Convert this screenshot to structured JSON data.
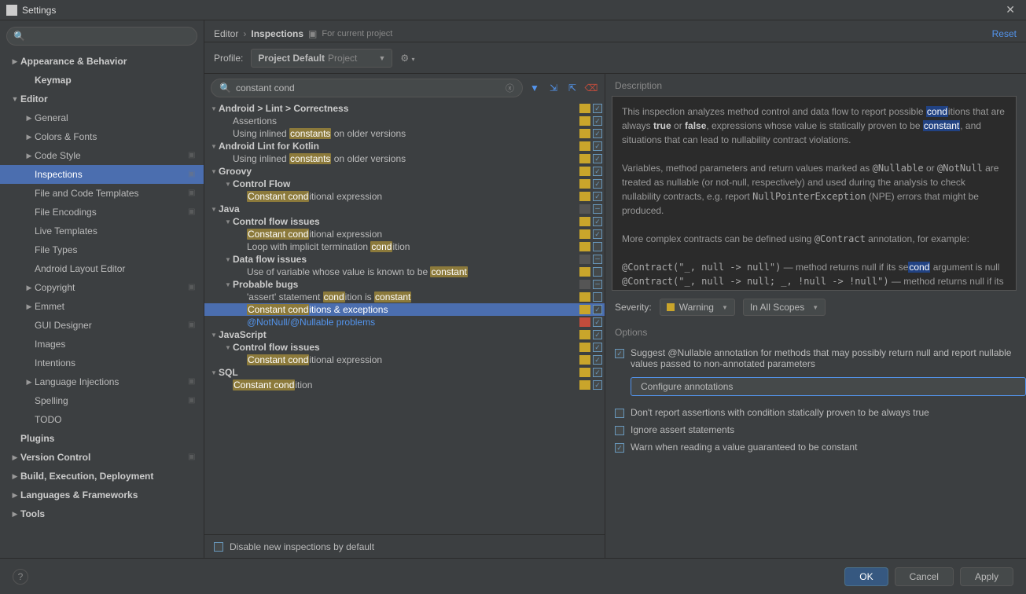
{
  "window": {
    "title": "Settings"
  },
  "header": {
    "crumb1": "Editor",
    "crumb2": "Inspections",
    "scope_label": "For current project",
    "reset": "Reset"
  },
  "profile": {
    "label": "Profile:",
    "name": "Project Default",
    "suffix": "Project"
  },
  "sidebar_search": "",
  "sidebar": [
    {
      "label": "Appearance & Behavior",
      "depth": 0,
      "arrow": "▶",
      "bold": true
    },
    {
      "label": "Keymap",
      "depth": 1,
      "arrow": "",
      "bold": true
    },
    {
      "label": "Editor",
      "depth": 0,
      "arrow": "▼",
      "bold": true
    },
    {
      "label": "General",
      "depth": 1,
      "arrow": "▶",
      "bold": false
    },
    {
      "label": "Colors & Fonts",
      "depth": 1,
      "arrow": "▶",
      "bold": false
    },
    {
      "label": "Code Style",
      "depth": 1,
      "arrow": "▶",
      "bold": false,
      "badge": true
    },
    {
      "label": "Inspections",
      "depth": 1,
      "arrow": "",
      "bold": false,
      "selected": true,
      "badge": true
    },
    {
      "label": "File and Code Templates",
      "depth": 1,
      "arrow": "",
      "bold": false,
      "badge": true
    },
    {
      "label": "File Encodings",
      "depth": 1,
      "arrow": "",
      "bold": false,
      "badge": true
    },
    {
      "label": "Live Templates",
      "depth": 1,
      "arrow": "",
      "bold": false
    },
    {
      "label": "File Types",
      "depth": 1,
      "arrow": "",
      "bold": false
    },
    {
      "label": "Android Layout Editor",
      "depth": 1,
      "arrow": "",
      "bold": false
    },
    {
      "label": "Copyright",
      "depth": 1,
      "arrow": "▶",
      "bold": false,
      "badge": true
    },
    {
      "label": "Emmet",
      "depth": 1,
      "arrow": "▶",
      "bold": false
    },
    {
      "label": "GUI Designer",
      "depth": 1,
      "arrow": "",
      "bold": false,
      "badge": true
    },
    {
      "label": "Images",
      "depth": 1,
      "arrow": "",
      "bold": false
    },
    {
      "label": "Intentions",
      "depth": 1,
      "arrow": "",
      "bold": false
    },
    {
      "label": "Language Injections",
      "depth": 1,
      "arrow": "▶",
      "bold": false,
      "badge": true
    },
    {
      "label": "Spelling",
      "depth": 1,
      "arrow": "",
      "bold": false,
      "badge": true
    },
    {
      "label": "TODO",
      "depth": 1,
      "arrow": "",
      "bold": false
    },
    {
      "label": "Plugins",
      "depth": 0,
      "arrow": "",
      "bold": true
    },
    {
      "label": "Version Control",
      "depth": 0,
      "arrow": "▶",
      "bold": true,
      "badge": true
    },
    {
      "label": "Build, Execution, Deployment",
      "depth": 0,
      "arrow": "▶",
      "bold": true
    },
    {
      "label": "Languages & Frameworks",
      "depth": 0,
      "arrow": "▶",
      "bold": true
    },
    {
      "label": "Tools",
      "depth": 0,
      "arrow": "▶",
      "bold": true
    }
  ],
  "insp_search": "constant cond",
  "insp_tree": [
    {
      "depth": 0,
      "arrow": "▼",
      "bold": true,
      "pre": "Android > Lint > Correctness",
      "hl": "",
      "post": "",
      "sev": "warn",
      "chk": "checked"
    },
    {
      "depth": 1,
      "arrow": "",
      "pre": "Assertions",
      "hl": "",
      "post": "",
      "sev": "warn",
      "chk": "checked"
    },
    {
      "depth": 1,
      "arrow": "",
      "pre": "Using inlined ",
      "hl": "constants",
      "post": " on older versions",
      "sev": "warn",
      "chk": "checked"
    },
    {
      "depth": 0,
      "arrow": "▼",
      "bold": true,
      "pre": "Android Lint for Kotlin",
      "hl": "",
      "post": "",
      "sev": "warn",
      "chk": "checked"
    },
    {
      "depth": 1,
      "arrow": "",
      "pre": "Using inlined ",
      "hl": "constants",
      "post": " on older versions",
      "sev": "warn",
      "chk": "checked"
    },
    {
      "depth": 0,
      "arrow": "▼",
      "bold": true,
      "pre": "Groovy",
      "hl": "",
      "post": "",
      "sev": "warn",
      "chk": "checked"
    },
    {
      "depth": 1,
      "arrow": "▼",
      "bold": true,
      "pre": "Control Flow",
      "hl": "",
      "post": "",
      "sev": "warn",
      "chk": "checked"
    },
    {
      "depth": 2,
      "arrow": "",
      "pre": "",
      "hl": "Constant cond",
      "post": "itional expression",
      "sev": "warn",
      "chk": "checked"
    },
    {
      "depth": 0,
      "arrow": "▼",
      "bold": true,
      "pre": "Java",
      "hl": "",
      "post": "",
      "sev": "none",
      "chk": "dash"
    },
    {
      "depth": 1,
      "arrow": "▼",
      "bold": true,
      "pre": "Control flow issues",
      "hl": "",
      "post": "",
      "sev": "warn",
      "chk": "checked"
    },
    {
      "depth": 2,
      "arrow": "",
      "pre": "",
      "hl": "Constant cond",
      "post": "itional expression",
      "sev": "warn",
      "chk": "checked"
    },
    {
      "depth": 2,
      "arrow": "",
      "pre": "Loop with implicit termination ",
      "hl": "cond",
      "post": "ition",
      "sev": "warn",
      "chk": ""
    },
    {
      "depth": 1,
      "arrow": "▼",
      "bold": true,
      "pre": "Data flow issues",
      "hl": "",
      "post": "",
      "sev": "none",
      "chk": "dash"
    },
    {
      "depth": 2,
      "arrow": "",
      "pre": "Use of variable whose value is known to be ",
      "hl": "constant",
      "post": "",
      "sev": "warn",
      "chk": ""
    },
    {
      "depth": 1,
      "arrow": "▼",
      "bold": true,
      "pre": "Probable bugs",
      "hl": "",
      "post": "",
      "blue": true,
      "sev": "none",
      "chk": "dash"
    },
    {
      "depth": 2,
      "arrow": "",
      "pre": "'assert' statement ",
      "hl": "cond",
      "post": "ition is ",
      "hl2": "constant",
      "post2": "",
      "sev": "warn",
      "chk": ""
    },
    {
      "depth": 2,
      "arrow": "",
      "pre": "",
      "hl": "Constant cond",
      "post": "itions & exceptions",
      "blue": true,
      "selected": true,
      "sev": "warn",
      "chk": "checked"
    },
    {
      "depth": 2,
      "arrow": "",
      "pre": "@NotNull/@Nullable problems",
      "hl": "",
      "post": "",
      "blue": true,
      "sev": "err",
      "chk": "checked"
    },
    {
      "depth": 0,
      "arrow": "▼",
      "bold": true,
      "pre": "JavaScript",
      "hl": "",
      "post": "",
      "sev": "warn",
      "chk": "checked"
    },
    {
      "depth": 1,
      "arrow": "▼",
      "bold": true,
      "pre": "Control flow issues",
      "hl": "",
      "post": "",
      "sev": "warn",
      "chk": "checked"
    },
    {
      "depth": 2,
      "arrow": "",
      "pre": "",
      "hl": "Constant cond",
      "post": "itional expression",
      "sev": "warn",
      "chk": "checked"
    },
    {
      "depth": 0,
      "arrow": "▼",
      "bold": true,
      "pre": "SQL",
      "hl": "",
      "post": "",
      "sev": "warn",
      "chk": "checked"
    },
    {
      "depth": 1,
      "arrow": "",
      "pre": "",
      "hl": "Constant cond",
      "post": "ition",
      "sev": "warn",
      "chk": "checked"
    }
  ],
  "disable_label": "Disable new inspections by default",
  "details": {
    "title": "Description",
    "severity_label": "Severity:",
    "severity_value": "Warning",
    "scope_value": "In All Scopes",
    "options_title": "Options",
    "opt1": "Suggest @Nullable annotation for methods that may possibly return null and report nullable values passed to non-annotated parameters",
    "cfg_btn": "Configure annotations",
    "opt2_pre": "Don't report assertions with condition statically proven to be always ",
    "opt2_code": "true",
    "opt3": "Ignore assert statements",
    "opt4": "Warn when reading a value guaranteed to be constant"
  },
  "footer": {
    "ok": "OK",
    "cancel": "Cancel",
    "apply": "Apply"
  }
}
